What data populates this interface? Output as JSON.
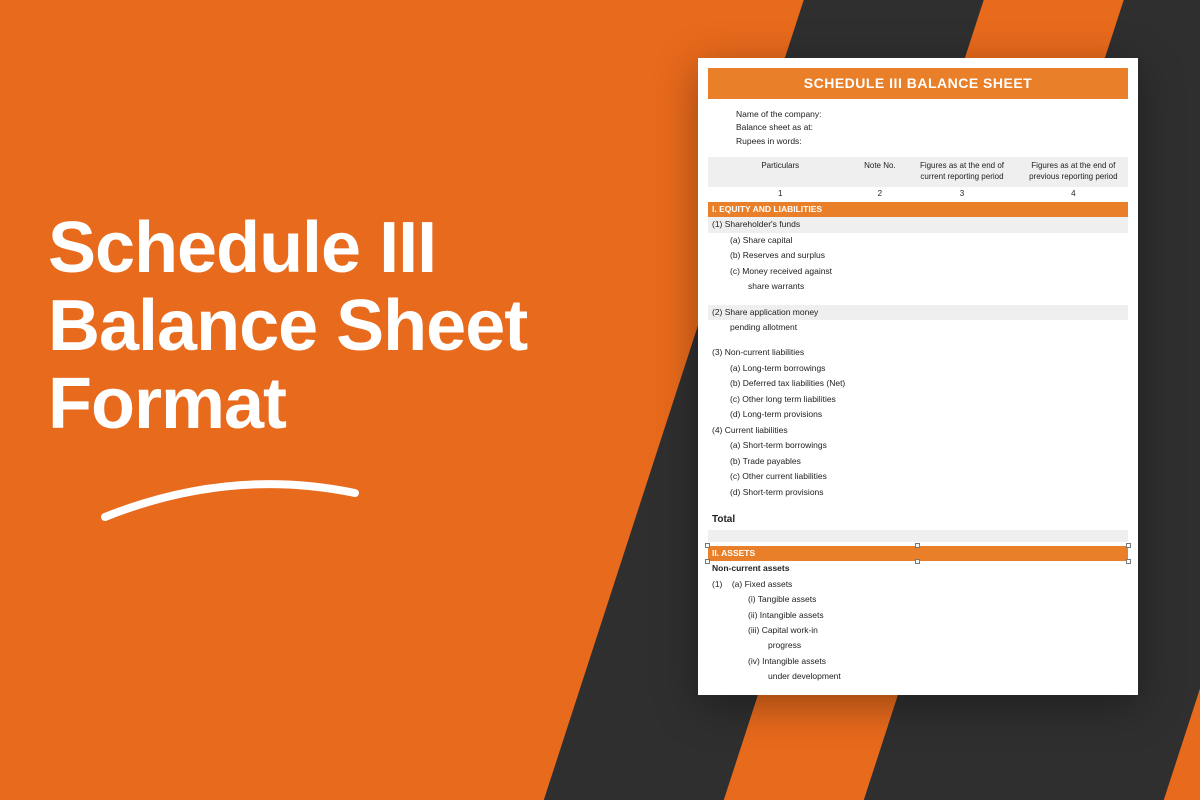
{
  "headline": {
    "line1": "Schedule III",
    "line2": "Balance Sheet",
    "line3": "Format"
  },
  "doc": {
    "title": "SCHEDULE III BALANCE SHEET",
    "meta": {
      "company": "Name of the company:",
      "asAt": "Balance sheet as at:",
      "rupees": "Rupees in words:"
    },
    "columns": {
      "particulars": "Particulars",
      "noteNo": "Note No.",
      "current": "Figures as at the end of current reporting period",
      "previous": "Figures as at the end of previous reporting period"
    },
    "colNums": {
      "c1": "1",
      "c2": "2",
      "c3": "3",
      "c4": "4"
    },
    "section1": "I. EQUITY AND LIABILITIES",
    "shareholders": {
      "header": "(1) Shareholder's funds",
      "a": "(a) Share capital",
      "b": "(b) Reserves and surplus",
      "c": "(c) Money received against",
      "c2": "share warrants"
    },
    "shareApp": {
      "l1": "(2) Share application money",
      "l2": "pending allotment"
    },
    "noncurrent": {
      "header": "(3) Non-current liabilities",
      "a": "(a) Long-term borrowings",
      "b": "(b) Deferred tax liabilities (Net)",
      "c": "(c) Other long term liabilities",
      "d": "(d) Long-term provisions"
    },
    "current": {
      "header": "(4) Current liabilities",
      "a": "(a) Short-term borrowings",
      "b": "(b) Trade payables",
      "c": "(c) Other current liabilities",
      "d": "(d) Short-term provisions"
    },
    "total": "Total",
    "section2": "II. ASSETS",
    "nca": "Non-current assets",
    "fixed": {
      "num": "(1)",
      "header": "(a) Fixed assets",
      "i": "(i) Tangible assets",
      "ii": "(ii) Intangible assets",
      "iii": "(iii) Capital work-in",
      "iii2": "progress",
      "iv": "(iv) Intangible assets",
      "iv2": "under development"
    }
  }
}
